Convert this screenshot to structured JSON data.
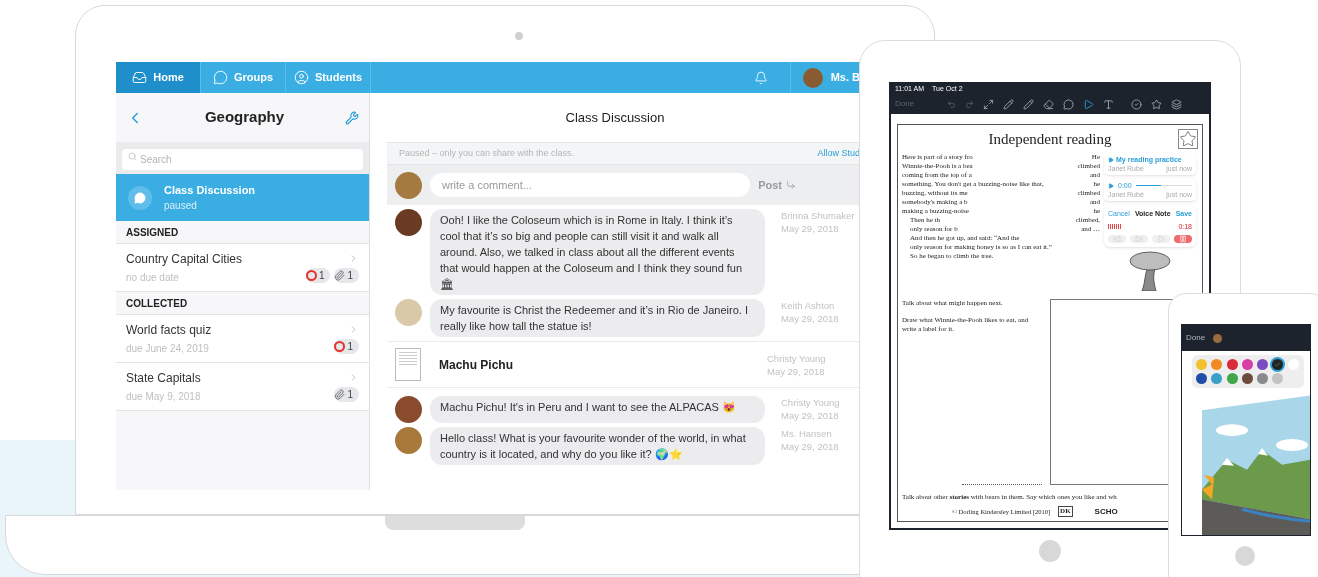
{
  "laptop": {
    "nav": {
      "tabs": [
        {
          "label": "Home",
          "selected": true
        },
        {
          "label": "Groups",
          "selected": false
        },
        {
          "label": "Students",
          "selected": false
        }
      ],
      "user_name": "Ms. B"
    },
    "sidebar": {
      "title": "Geography",
      "search": {
        "placeholder": "Search"
      },
      "current": {
        "title": "Class Discussion",
        "subtitle": "paused",
        "selected": true
      },
      "sections": [
        {
          "heading": "ASSIGNED",
          "items": [
            {
              "title": "Country Capital Cities",
              "due": "no due date",
              "badges": [
                {
                  "kind": "ring",
                  "count": "1"
                },
                {
                  "kind": "clip",
                  "count": "1"
                }
              ]
            }
          ]
        },
        {
          "heading": "COLLECTED",
          "items": [
            {
              "title": "World facts quiz",
              "due": "due June 24, 2019",
              "badges": [
                {
                  "kind": "ring",
                  "count": "1"
                }
              ]
            },
            {
              "title": "State Capitals",
              "due": "due May 9, 2018",
              "badges": [
                {
                  "kind": "clip",
                  "count": "1"
                }
              ]
            }
          ]
        }
      ]
    },
    "discussion": {
      "title": "Class Discussion",
      "notice": "Paused – only you can share with the class.",
      "notice_link": "Allow Stud",
      "comment": {
        "placeholder": "write a comment...",
        "post": "Post"
      },
      "posts": [
        {
          "kind": "message",
          "text": "Ooh! I like the Coloseum which is in Rome in Italy. I think it’s cool that it’s so big and people can still visit it and walk all around. Also, we talked in class about all the different events that would happen at the Coloseum and I think they sound fun 🏛",
          "author": "Brinna Shumaker",
          "date": "May 29, 2018",
          "color": "#6b3a22"
        },
        {
          "kind": "message",
          "text": "My favourite is Christ the Redeemer and it’s in Rio de Janeiro. I really like how tall the statue is!",
          "author": "Keith Ashton",
          "date": "May 29, 2018",
          "color": "#d9c9a8"
        },
        {
          "kind": "document",
          "text": "Machu Pichu",
          "author": "Christy Young",
          "date": "May 29, 2018"
        },
        {
          "kind": "message",
          "text": "Machu Pichu! It's in Peru and I want to see the ALPACAS 😻",
          "author": "Christy Young",
          "date": "May 29, 2018",
          "color": "#8a4a2c"
        },
        {
          "kind": "message",
          "text": "Hello class! What is your favourite wonder of the world, in what country is it located, and why do you like it? 🌍⭐",
          "author": "Ms. Hansen",
          "date": "May 29, 2018",
          "color": "#a77a3c"
        }
      ]
    }
  },
  "tablet": {
    "status": {
      "time": "11:01 AM",
      "date": "Tue Oct 2"
    },
    "done": "Done",
    "worksheet": {
      "title": "Independent reading",
      "story": [
        "Here is part of a story fro",
        "Winnie-the-Pooh is a bea",
        "coming from the top of a",
        "something. You don't get a buzzing-noise like that,",
        "buzzing, without its me",
        "somebody's making a b",
        "making a buzzing-noise",
        "Then he th",
        "only reason for b",
        "And then he got up, and said: “And the",
        "only reason for making honey is so as I can eat it.”",
        "So he began to climb the tree."
      ],
      "climb": [
        "He",
        "climbed",
        "and",
        "he",
        "climbed",
        "and",
        "he",
        "climbed,",
        "and …"
      ],
      "prompts": [
        "Talk about what might happen next.",
        "Draw what Winnie-the-Pooh likes to eat, and write a label for it."
      ],
      "footer_prompt": "Talk about other **stories** with bears in them. Say which ones you like and wh",
      "copyright": "© Dorling Kindersley Limited [2010]",
      "publisher": "DK",
      "brand": "SCHO"
    },
    "reading_note": {
      "title": "My reading practice",
      "author": "Janet Rubé",
      "time": "just now"
    },
    "audio_note": {
      "time": "0:00",
      "level": 0.45,
      "author": "Janet Rubé",
      "when": "just now"
    },
    "voice_note": {
      "cancel": "Cancel",
      "title": "Voice Note",
      "save": "Save",
      "elapsed": "0:18"
    }
  },
  "phone": {
    "done": "Done",
    "palette": [
      {
        "color": "#f2c12e",
        "selected": false
      },
      {
        "color": "#f08a24",
        "selected": false
      },
      {
        "color": "#d92b3a",
        "selected": false
      },
      {
        "color": "#d63fa6",
        "selected": false
      },
      {
        "color": "#7b4bc2",
        "selected": false
      },
      {
        "color": "#222222",
        "selected": true
      },
      {
        "color": "#ffffff",
        "selected": false
      },
      {
        "color": "#1e4fa8",
        "selected": false
      },
      {
        "color": "#3aa0c8",
        "selected": false
      },
      {
        "color": "#3ea84a",
        "selected": false
      },
      {
        "color": "#6d4c3d",
        "selected": false
      },
      {
        "color": "#8a8a8a",
        "selected": false
      },
      {
        "color": "#c4c4c4",
        "selected": false
      }
    ]
  }
}
